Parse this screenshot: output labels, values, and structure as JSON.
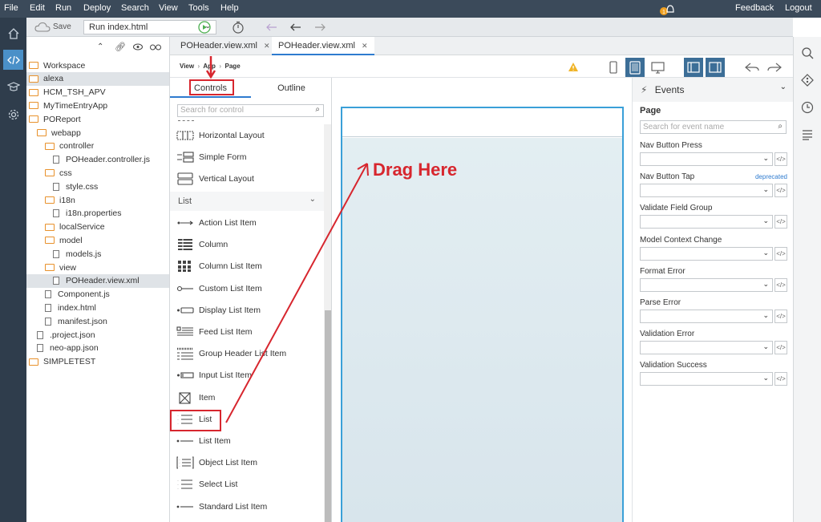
{
  "menu": [
    "File",
    "Edit",
    "Run",
    "Deploy",
    "Search",
    "View",
    "Tools",
    "Help"
  ],
  "menu_right": {
    "feedback": "Feedback",
    "logout": "Logout",
    "notification_count": "1"
  },
  "toolbar": {
    "save_label": "Save",
    "run_select_value": "Run index.html"
  },
  "tree": [
    {
      "label": "Workspace",
      "kind": "folder"
    },
    {
      "label": "alexa",
      "kind": "folder"
    },
    {
      "label": "HCM_TSH_APV",
      "kind": "folder"
    },
    {
      "label": "MyTimeEntryApp",
      "kind": "folder"
    },
    {
      "label": "POReport",
      "kind": "folder"
    },
    {
      "label": "webapp",
      "kind": "folder"
    },
    {
      "label": "controller",
      "kind": "folder"
    },
    {
      "label": "POHeader.controller.js",
      "kind": "file"
    },
    {
      "label": "css",
      "kind": "folder"
    },
    {
      "label": "style.css",
      "kind": "file"
    },
    {
      "label": "i18n",
      "kind": "folder"
    },
    {
      "label": "i18n.properties",
      "kind": "file"
    },
    {
      "label": "localService",
      "kind": "folder"
    },
    {
      "label": "model",
      "kind": "folder"
    },
    {
      "label": "models.js",
      "kind": "file"
    },
    {
      "label": "view",
      "kind": "folder"
    },
    {
      "label": "POHeader.view.xml",
      "kind": "file"
    },
    {
      "label": "Component.js",
      "kind": "file"
    },
    {
      "label": "index.html",
      "kind": "file"
    },
    {
      "label": "manifest.json",
      "kind": "file"
    },
    {
      "label": ".project.json",
      "kind": "file"
    },
    {
      "label": "neo-app.json",
      "kind": "file"
    },
    {
      "label": "SIMPLETEST",
      "kind": "folder"
    }
  ],
  "editor_tabs": [
    "POHeader.view.xml",
    "POHeader.view.xml"
  ],
  "breadcrumb": {
    "view": "View",
    "app": "App",
    "page": "Page"
  },
  "palette": {
    "tab_controls": "Controls",
    "tab_outline": "Outline",
    "search_placeholder": "Search for control",
    "section_list": "List",
    "layout_items": [
      "Horizontal Layout",
      "Simple Form",
      "Vertical Layout"
    ],
    "list_items": [
      "Action List Item",
      "Column",
      "Column List Item",
      "Custom List Item",
      "Display List Item",
      "Feed List Item",
      "Group Header List Item",
      "Input List Item",
      "Item",
      "List",
      "List Item",
      "Object List Item",
      "Select List",
      "Standard List Item"
    ]
  },
  "annotation": {
    "drag_text": "Drag Here"
  },
  "events": {
    "title": "Events",
    "page_label": "Page",
    "search_placeholder": "Search for event name",
    "deprecated": "deprecated",
    "code_label": "</>",
    "items": [
      "Nav Button Press",
      "Nav Button Tap",
      "Validate Field Group",
      "Model Context Change",
      "Format Error",
      "Parse Error",
      "Validation Error",
      "Validation Success"
    ]
  },
  "colors": {
    "menubar": "#3b4a5a",
    "accent": "#2e7bcf",
    "annotation": "#d7262e",
    "folder": "#e8912b"
  }
}
